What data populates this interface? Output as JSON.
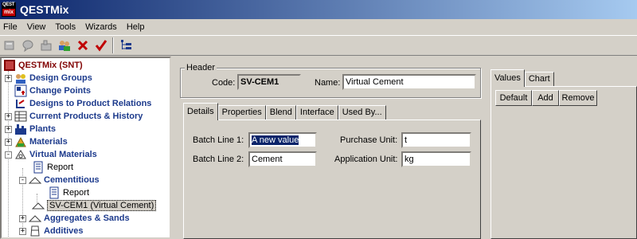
{
  "window": {
    "title": "QESTMix",
    "icon_top": "QEST",
    "icon_bottom": "mix"
  },
  "menu": [
    "File",
    "View",
    "Tools",
    "Wizards",
    "Help"
  ],
  "toolbar": {
    "icons": [
      "new-record-icon",
      "comment-icon",
      "batch-icon",
      "users-icon",
      "delete-icon",
      "checkmark-icon",
      "tree-view-icon"
    ],
    "colors": {
      "delete": "#c00000",
      "check": "#c00000",
      "tree": "#1c3a8c"
    }
  },
  "tree": {
    "items": [
      {
        "label": "QESTMix (SNT)",
        "style": "root",
        "icon": "app-icon",
        "expander": ""
      },
      {
        "label": "Design Groups",
        "style": "bold",
        "icon": "design-groups-icon",
        "expander": "+"
      },
      {
        "label": "Change Points",
        "style": "bold",
        "icon": "change-points-icon",
        "expander": ""
      },
      {
        "label": "Designs to Product Relations",
        "style": "bold",
        "icon": "relations-icon",
        "expander": ""
      },
      {
        "label": "Current Products & History",
        "style": "bold",
        "icon": "products-icon",
        "expander": "+"
      },
      {
        "label": "Plants",
        "style": "bold",
        "icon": "plant-icon",
        "expander": "+"
      },
      {
        "label": "Materials",
        "style": "bold",
        "icon": "materials-icon",
        "expander": "+"
      },
      {
        "label": "Virtual Materials",
        "style": "bold",
        "icon": "virtual-materials-icon",
        "expander": "-"
      },
      {
        "label": "Report",
        "style": "normal",
        "icon": "report-icon",
        "expander": ""
      },
      {
        "label": "Cementitious",
        "style": "bold",
        "icon": "cone-icon",
        "expander": "-"
      },
      {
        "label": "Report",
        "style": "normal",
        "icon": "report-icon",
        "expander": ""
      },
      {
        "label": "SV-CEM1 (Virtual Cement)",
        "style": "selected",
        "icon": "cone-icon",
        "expander": ""
      },
      {
        "label": "Aggregates & Sands",
        "style": "bold",
        "icon": "cone-icon",
        "expander": "+"
      },
      {
        "label": "Additives",
        "style": "bold",
        "icon": "additive-icon",
        "expander": "+"
      }
    ]
  },
  "header": {
    "legend": "Header",
    "code_label": "Code:",
    "code_value": "SV-CEM1",
    "name_label": "Name:",
    "name_value": "Virtual Cement"
  },
  "detail_tabs": [
    "Details",
    "Properties",
    "Blend",
    "Interface",
    "Used By..."
  ],
  "details": {
    "batch_line_1_label": "Batch Line 1:",
    "batch_line_1_value": "A new value",
    "batch_line_2_label": "Batch Line 2:",
    "batch_line_2_value": "Cement",
    "purchase_unit_label": "Purchase Unit:",
    "purchase_unit_value": "t",
    "application_unit_label": "Application Unit:",
    "application_unit_value": "kg"
  },
  "right_tabs": [
    "Values",
    "Chart"
  ],
  "right_buttons": [
    "Default",
    "Add",
    "Remove"
  ]
}
